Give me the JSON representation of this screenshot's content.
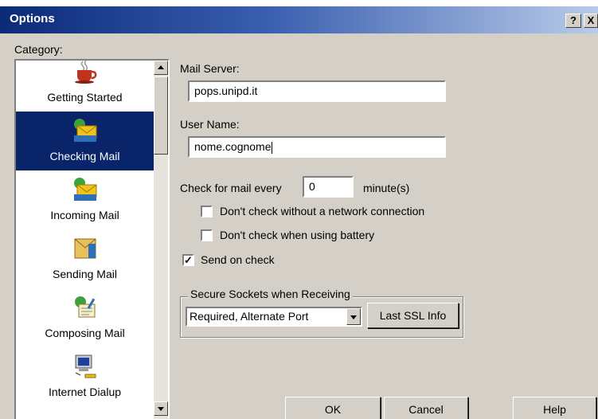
{
  "window": {
    "title": "Options",
    "help_glyph": "?",
    "close_glyph": "X"
  },
  "category": {
    "label": "Category:",
    "items": [
      {
        "label": "Getting Started",
        "icon": "coffee-cup-icon",
        "selected": false
      },
      {
        "label": "Checking Mail",
        "icon": "checking-mail-icon",
        "selected": true
      },
      {
        "label": "Incoming Mail",
        "icon": "incoming-mail-icon",
        "selected": false
      },
      {
        "label": "Sending Mail",
        "icon": "sending-mail-icon",
        "selected": false
      },
      {
        "label": "Composing Mail",
        "icon": "composing-mail-icon",
        "selected": false
      },
      {
        "label": "Internet Dialup",
        "icon": "dialup-computer-icon",
        "selected": false
      }
    ]
  },
  "mail_server": {
    "label": "Mail Server:",
    "value": "pops.unipd.it"
  },
  "user_name": {
    "label": "User Name:",
    "value": "nome.cognome"
  },
  "check_interval": {
    "prefix": "Check for mail every",
    "value": "0",
    "suffix": "minute(s)"
  },
  "options": [
    {
      "label": "Don't check without a network connection",
      "checked": false
    },
    {
      "label": "Don't check when using battery",
      "checked": false
    },
    {
      "label": "Send on check",
      "checked": true
    }
  ],
  "ssl": {
    "legend": "Secure Sockets when Receiving",
    "selected": "Required, Alternate Port",
    "info_button": "Last SSL Info"
  },
  "buttons": {
    "ok": "OK",
    "cancel": "Cancel",
    "help": "Help"
  },
  "colors": {
    "selection": "#0a246a",
    "face": "#d4d0c8",
    "title_start": "#0b2a78"
  }
}
